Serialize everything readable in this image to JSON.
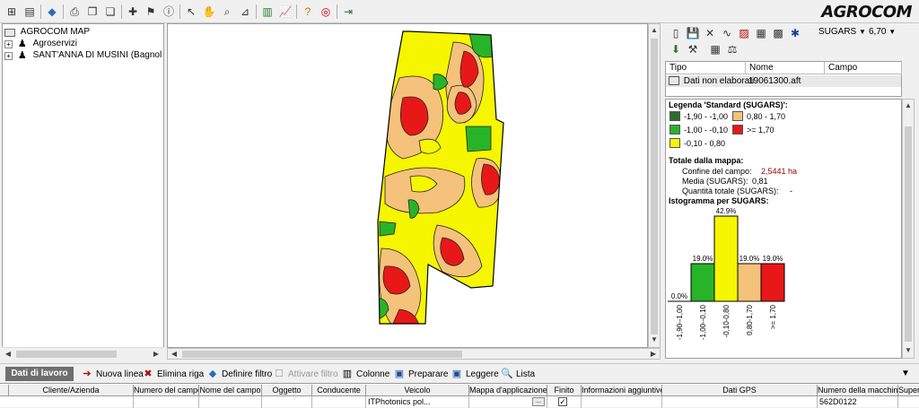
{
  "app": {
    "brand": "AGROCOM"
  },
  "toolbar": {
    "icons": [
      "tree-toggle-icon",
      "document-icon",
      "diamond-filter-icon",
      "print-icon",
      "copy-map-icon",
      "paste-map-icon",
      "new-layer-icon",
      "flag-icon",
      "info-icon",
      "pointer-icon",
      "hand-icon",
      "zoom-icon",
      "measure-icon",
      "legend-chart-icon",
      "line-chart-icon",
      "help-icon",
      "lifebuoy-icon",
      "exit-icon"
    ]
  },
  "tree": {
    "root": "AGROCOM MAP",
    "items": [
      {
        "label": "Agroservizi"
      },
      {
        "label": "SANT'ANNA DI MUSINI (Bagnoli di S"
      }
    ]
  },
  "right_toolbar": {
    "layer_select": "SUGARS",
    "value_select": "6,70"
  },
  "data_list": {
    "columns": [
      "Tipo",
      "Nome",
      "Campo"
    ],
    "rows": [
      {
        "tipo": "Dati non elaborati",
        "nome": "19061300.aft",
        "campo": ""
      }
    ]
  },
  "legend": {
    "title": "Legenda 'Standard (SUGARS)':",
    "classes": [
      {
        "label": "-1,90 - -1,00",
        "color": "#2e6b2e"
      },
      {
        "label": "0,80 - 1,70",
        "color": "#f4c27a"
      },
      {
        "label": "-1,00 - -0,10",
        "color": "#28b428"
      },
      {
        "label": ">= 1,70",
        "color": "#e81818"
      },
      {
        "label": "-0,10 - 0,80",
        "color": "#f6f600"
      }
    ],
    "totals_title": "Totale dalla mappa:",
    "boundary_label": "Confine del campo:",
    "boundary_value": "2,5441 ha",
    "mean_label": "Media (SUGARS):",
    "mean_value": "0,81",
    "qty_label": "Quantità totale (SUGARS):",
    "qty_value": "-",
    "hist_title": "Istogramma per SUGARS:"
  },
  "chart_data": {
    "type": "bar",
    "title": "Istogramma per SUGARS:",
    "categories": [
      "-1,90--1,00",
      "-1,00--0,10",
      "-0,10-0,80",
      "0,80-1,70",
      ">= 1,70"
    ],
    "values": [
      0.0,
      19.0,
      42.9,
      19.0,
      19.0
    ],
    "value_labels": [
      "0.0%",
      "19.0%",
      "42.9%",
      "19.0%",
      "19.0%"
    ],
    "colors": [
      "#2e6b2e",
      "#28b428",
      "#f6f600",
      "#f4c27a",
      "#e81818"
    ],
    "ylim": [
      0,
      42.9
    ]
  },
  "bottom_toolbar": {
    "tab": "Dati di lavoro",
    "new_row": "Nuova linea",
    "delete_row": "Elimina riga",
    "define_filter": "Definire filtro",
    "activate_filter": "Attivare filtro",
    "columns": "Colonne",
    "prepare": "Preparare",
    "read": "Leggere",
    "list": "Lista"
  },
  "grid": {
    "columns": [
      "Cliente/Azienda",
      "Numero del campo",
      "Nome del campo",
      "Oggetto",
      "Conducente",
      "Veicolo",
      "Mappa d'applicazione",
      "Finito",
      "Informazioni aggiuntive",
      "Dati GPS",
      "Numero della macchina",
      "Superficie"
    ],
    "row": {
      "veicolo": "ITPhotonics pol...",
      "mappa": "...",
      "macchina": "562D0122"
    }
  }
}
